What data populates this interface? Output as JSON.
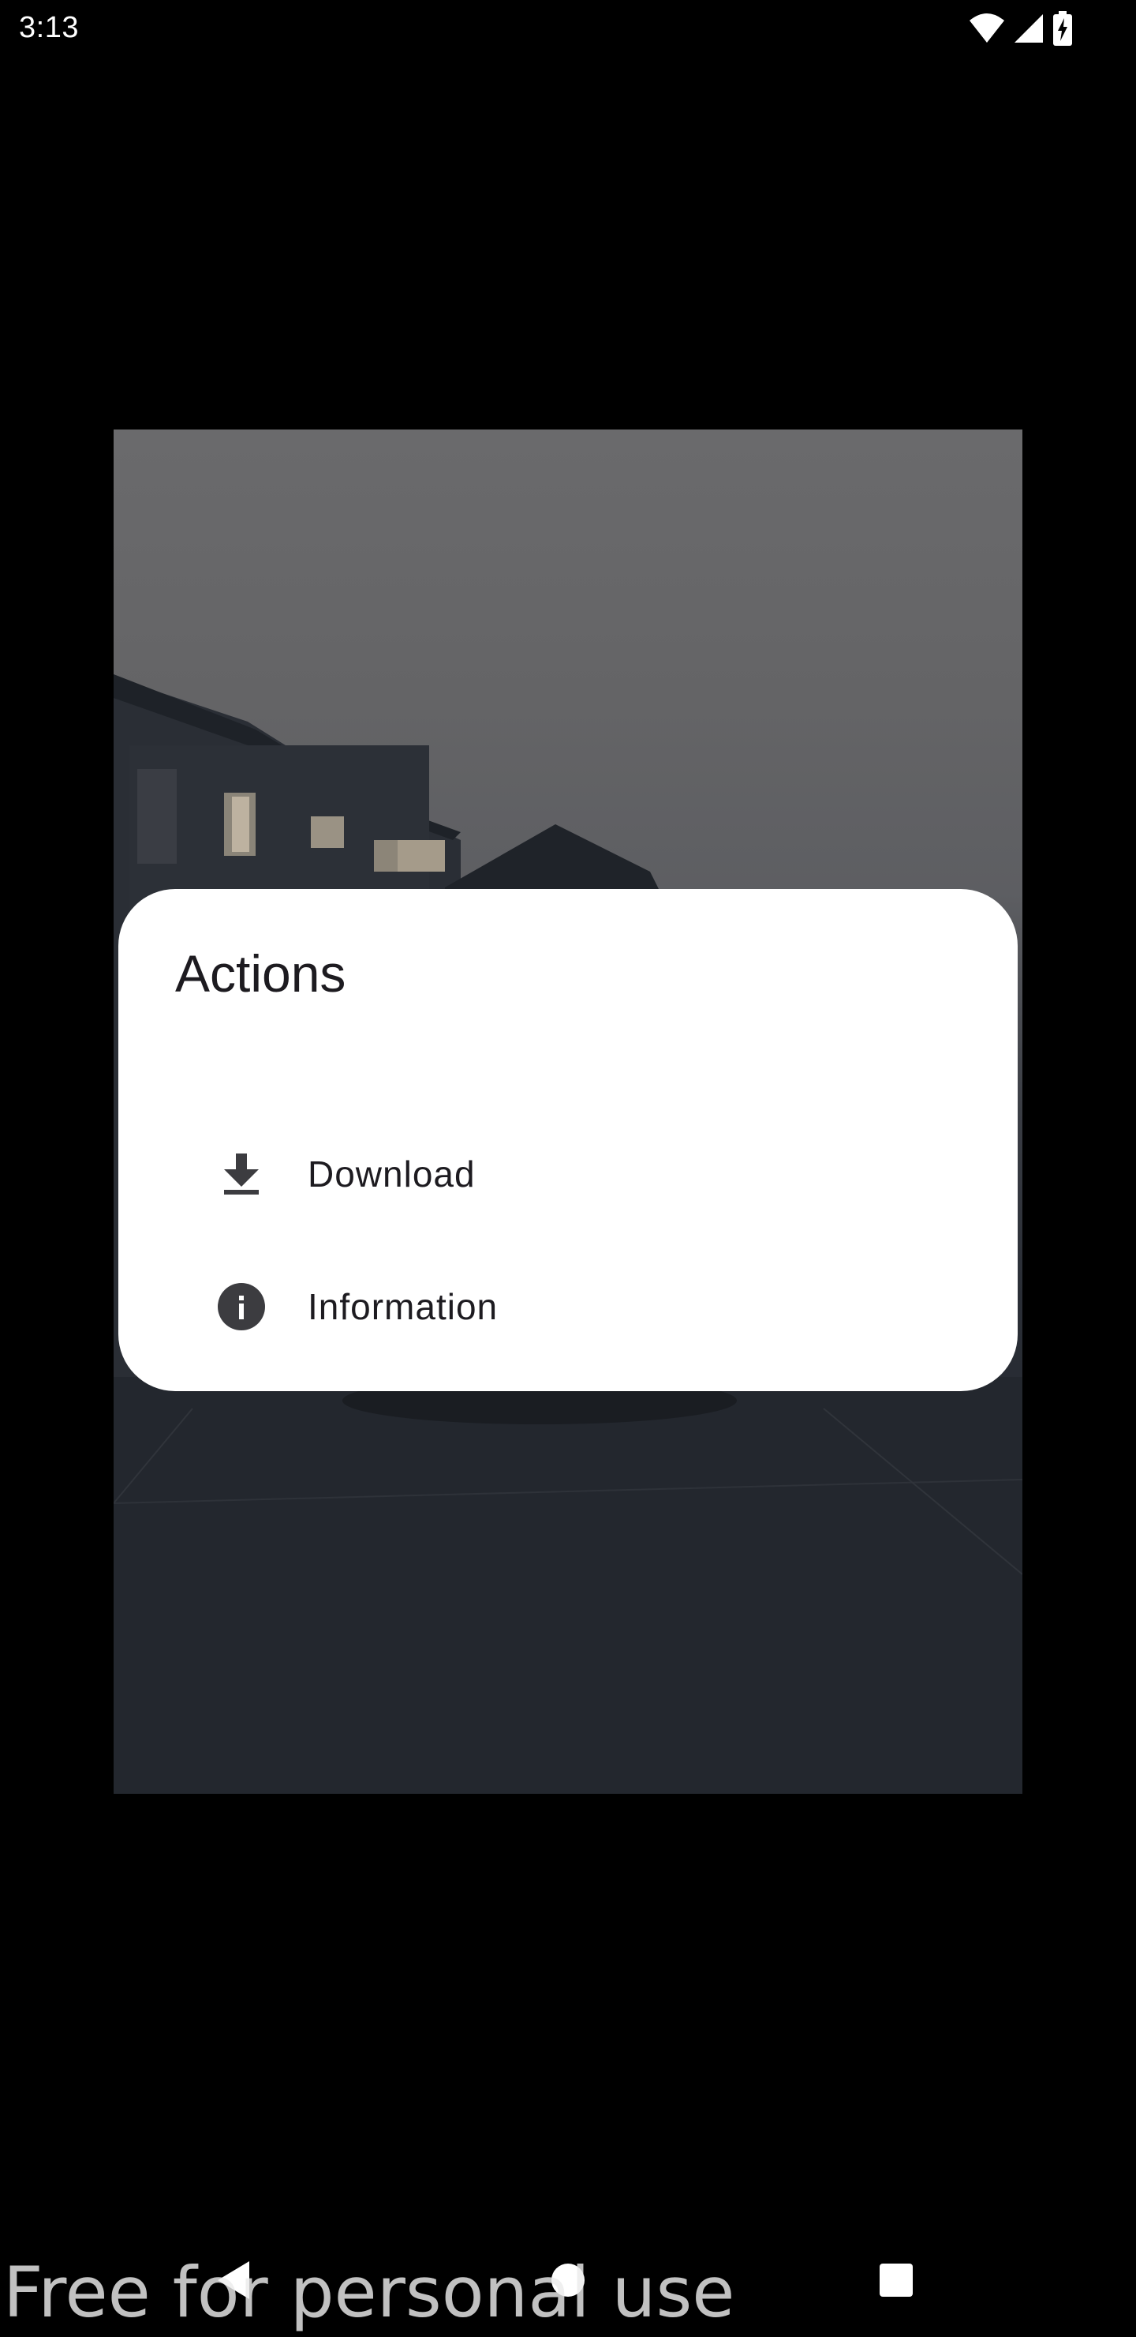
{
  "status_bar": {
    "time": "3:13",
    "icons": [
      "wifi-icon",
      "cell-signal-icon",
      "battery-charging-icon"
    ]
  },
  "dialog": {
    "title": "Actions",
    "items": [
      {
        "label": "Download",
        "icon": "download-icon"
      },
      {
        "label": "Information",
        "icon": "info-icon"
      }
    ]
  },
  "navigation": {
    "buttons": [
      "back-icon",
      "home-icon",
      "recents-icon"
    ]
  },
  "watermark": "Free for personal use",
  "colors": {
    "scrim_background": "#000000",
    "dialog_surface": "#ffffff",
    "text_primary": "#1d1b20",
    "icon": "#3c3c40"
  }
}
